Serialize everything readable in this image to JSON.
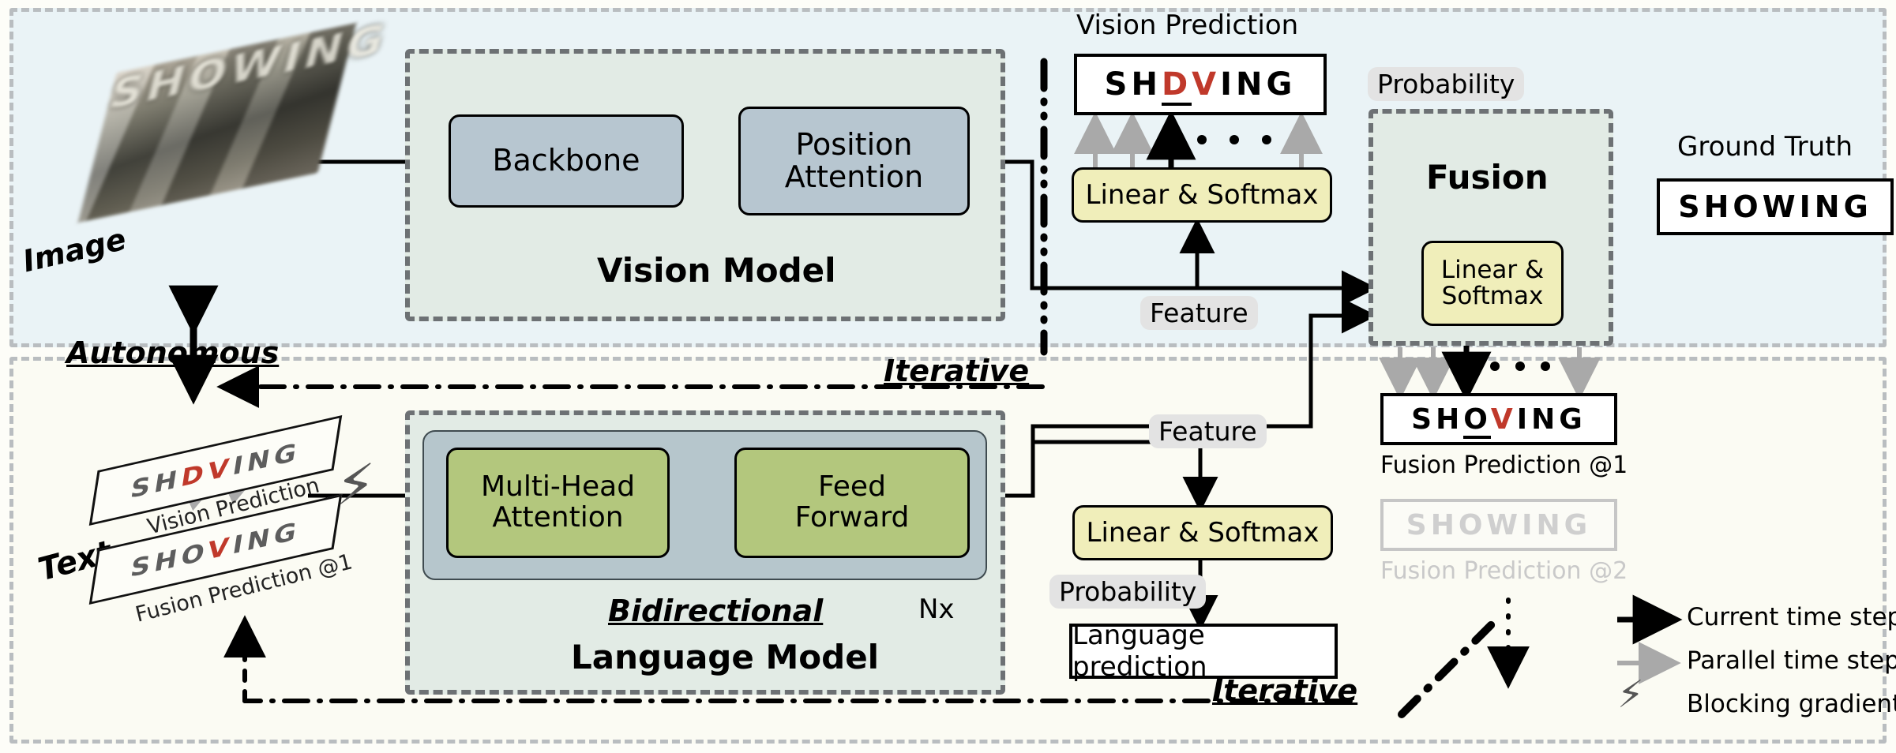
{
  "regions": {
    "vision_region_label": "Autonomous",
    "iterative_top": "Iterative",
    "iterative_bottom": "Iterative"
  },
  "image_input": {
    "label": "Image",
    "photo_text": "SHOWING"
  },
  "vision_model": {
    "title": "Vision Model",
    "blocks": [
      {
        "label": "Backbone"
      },
      {
        "label": "Position\nAttention"
      }
    ]
  },
  "language_model": {
    "title_italic": "Bidirectional",
    "title": "Language Model",
    "repeat": "Nx",
    "blocks": [
      {
        "label": "Multi-Head\nAttention"
      },
      {
        "label": "Feed\nForward"
      }
    ]
  },
  "vision_prediction": {
    "caption": "Vision Prediction",
    "letters": [
      {
        "ch": "S",
        "color": "black",
        "underline": false
      },
      {
        "ch": "H",
        "color": "black",
        "underline": false
      },
      {
        "ch": "D",
        "color": "red",
        "underline": true
      },
      {
        "ch": "V",
        "color": "red",
        "underline": false
      },
      {
        "ch": "I",
        "color": "black",
        "underline": false
      },
      {
        "ch": "N",
        "color": "black",
        "underline": false
      },
      {
        "ch": "G",
        "color": "black",
        "underline": false
      }
    ],
    "text": "SHDVING"
  },
  "fusion": {
    "title": "Fusion",
    "inner_block": "Linear &\nSoftmax"
  },
  "ground_truth": {
    "caption": "Ground Truth",
    "text": "SHOWING"
  },
  "softmax_vision": "Linear & Softmax",
  "softmax_language": "Linear & Softmax",
  "pills": {
    "probability_top": "Probability",
    "feature_vision": "Feature",
    "feature_language": "Feature",
    "probability_language": "Probability"
  },
  "language_prediction_box": "Language prediction",
  "fusion_prediction_1": {
    "caption": "Fusion Prediction @1",
    "text": "SHOVING",
    "letters": [
      {
        "ch": "S",
        "color": "black",
        "underline": false
      },
      {
        "ch": "H",
        "color": "black",
        "underline": false
      },
      {
        "ch": "O",
        "color": "black",
        "underline": true
      },
      {
        "ch": "V",
        "color": "red",
        "underline": false
      },
      {
        "ch": "I",
        "color": "black",
        "underline": false
      },
      {
        "ch": "N",
        "color": "black",
        "underline": false
      },
      {
        "ch": "G",
        "color": "black",
        "underline": false
      }
    ]
  },
  "fusion_prediction_2": {
    "caption": "Fusion Prediction @2",
    "text": "SHOWING"
  },
  "text_input": {
    "label": "Text",
    "plate1": {
      "caption": "Vision Prediction",
      "text": "SHDVING"
    },
    "plate2": {
      "caption": "Fusion Prediction @1",
      "text": "SHOVING"
    }
  },
  "legend": [
    {
      "icon": "black-arrow-icon",
      "label": "Current time step"
    },
    {
      "icon": "gray-arrow-icon",
      "label": "Parallel time step"
    },
    {
      "icon": "lightning-bolt-icon",
      "label": "Blocking gradient flow"
    }
  ],
  "colors": {
    "vision_bg": "#eaf3f6",
    "language_bg": "#fbfbf3",
    "module_bg": "#e2ebe5",
    "blue_block": "#b7c6d0",
    "green_block": "#b3c77d",
    "yellow_block": "#f0eeba",
    "accent_red": "#c0392b",
    "gray_arrow": "#a9a9a9",
    "pill_bg": "#e3e3e3"
  }
}
